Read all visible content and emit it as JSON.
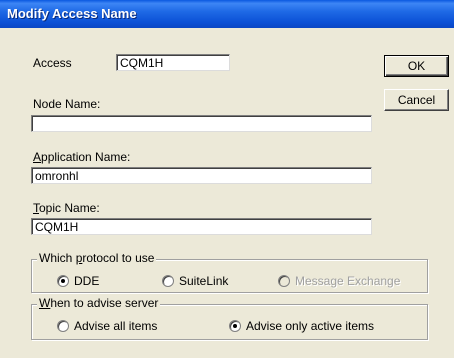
{
  "window": {
    "title": "Modify Access Name"
  },
  "access": {
    "label": "Access",
    "value": "CQM1H"
  },
  "buttons": {
    "ok": "OK",
    "cancel": "Cancel"
  },
  "node": {
    "label": "Node Name:",
    "value": ""
  },
  "application": {
    "label_ul": "A",
    "label_rest": "pplication Name:",
    "value": "omronhl"
  },
  "topic": {
    "label_ul": "T",
    "label_rest": "opic Name:",
    "value": "CQM1H"
  },
  "protocol": {
    "legend_pre": "Which ",
    "legend_ul": "p",
    "legend_post": "rotocol to use",
    "options": [
      "DDE",
      "SuiteLink",
      "Message Exchange"
    ],
    "selected": "DDE",
    "disabled": [
      "Message Exchange"
    ]
  },
  "advise": {
    "legend_ul": "W",
    "legend_rest": "hen to advise server",
    "options": [
      "Advise all items",
      "Advise only active items"
    ],
    "selected": "Advise only active items"
  }
}
